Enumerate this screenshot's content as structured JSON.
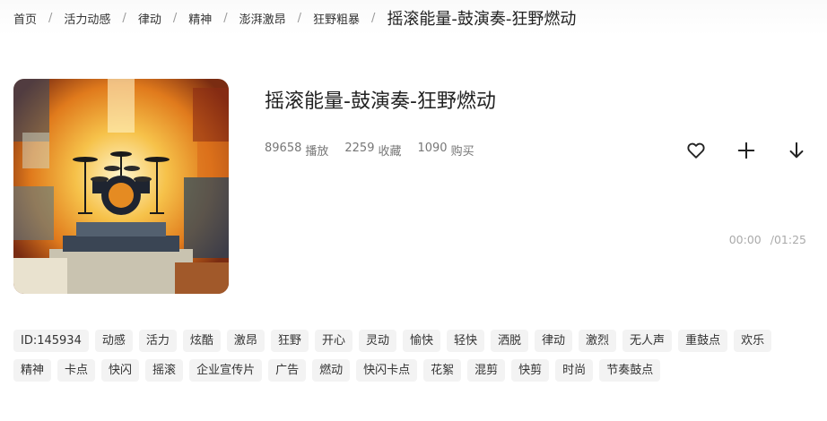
{
  "breadcrumb": {
    "items": [
      "首页",
      "活力动感",
      "律动",
      "精神",
      "澎湃激昂",
      "狂野粗暴"
    ],
    "separator": "/",
    "current": "摇滚能量-鼓演奏-狂野燃动"
  },
  "track": {
    "title": "摇滚能量-鼓演奏-狂野燃动",
    "plays_count": "89658",
    "plays_label": "播放",
    "favorites_count": "2259",
    "favorites_label": "收藏",
    "purchases_count": "1090",
    "purchases_label": "购买",
    "cover_icon": "drum-kit-artwork"
  },
  "actions": {
    "favorite_icon": "heart-icon",
    "add_icon": "plus-icon",
    "download_icon": "download-arrow-icon"
  },
  "player": {
    "current_time": "00:00",
    "duration": "/01:25"
  },
  "tags": [
    "ID:145934",
    "动感",
    "活力",
    "炫酷",
    "激昂",
    "狂野",
    "开心",
    "灵动",
    "愉快",
    "轻快",
    "洒脱",
    "律动",
    "激烈",
    "无人声",
    "重鼓点",
    "欢乐",
    "精神",
    "卡点",
    "快闪",
    "摇滚",
    "企业宣传片",
    "广告",
    "燃动",
    "快闪卡点",
    "花絮",
    "混剪",
    "快剪",
    "时尚",
    "节奏鼓点"
  ],
  "colors": {
    "text": "#222222",
    "muted": "#777777",
    "tag_bg": "#f3f3f3",
    "time": "#aaaaaa"
  }
}
